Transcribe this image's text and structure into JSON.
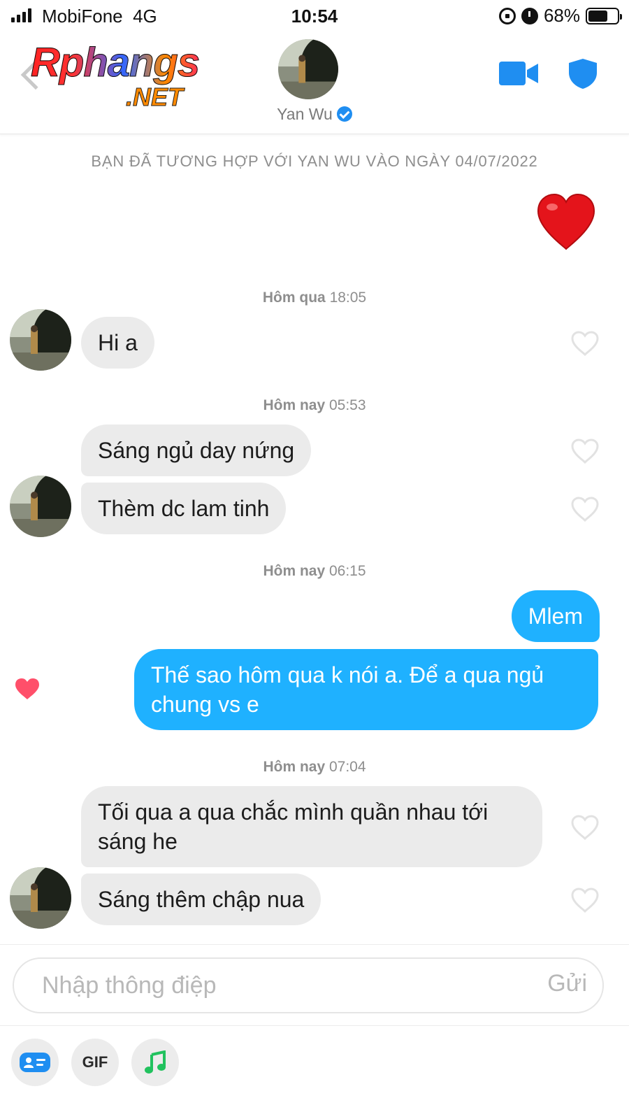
{
  "status_bar": {
    "carrier": "MobiFone",
    "network": "4G",
    "time": "10:54",
    "battery_percent": "68%",
    "battery_level": 0.68
  },
  "header": {
    "logo_main": "Rphangs",
    "logo_net": ".NET",
    "name": "Yan Wu",
    "verified": true,
    "icons": [
      "back-icon",
      "video-call-icon",
      "shield-icon",
      "verified-icon"
    ],
    "accent_color": "#1f8ef1"
  },
  "chat": {
    "match_notice": "BẠN ĐÃ TƯƠNG HỢP VỚI YAN WU VÀO NGÀY 04/07/2022",
    "groups": [
      {
        "day": "Hôm qua",
        "time": "18:05",
        "messages": [
          "Hi a"
        ]
      },
      {
        "day": "Hôm nay",
        "time": "05:53",
        "messages": [
          "Sáng ngủ day nứng",
          "Thèm dc lam tinh"
        ]
      },
      {
        "day": "Hôm nay",
        "time": "06:15",
        "messages": [
          "Mlem",
          "Thế sao hôm qua k nói a. Để a qua ngủ chung vs e"
        ]
      },
      {
        "day": "Hôm nay",
        "time": "07:04",
        "messages": [
          "Tối qua a qua chắc mình quần nhau tới sáng he",
          "Sáng thêm chập nua"
        ]
      }
    ],
    "colors": {
      "outgoing_bubble": "#1fb1ff",
      "incoming_bubble": "#ebebeb",
      "liked_heart": "#ff4f6a"
    }
  },
  "composer": {
    "placeholder": "Nhập thông điệp",
    "send_label": "Gửi",
    "gif_label": "GIF",
    "tools": [
      "sticker-card-icon",
      "gif-button",
      "music-note-icon"
    ]
  }
}
